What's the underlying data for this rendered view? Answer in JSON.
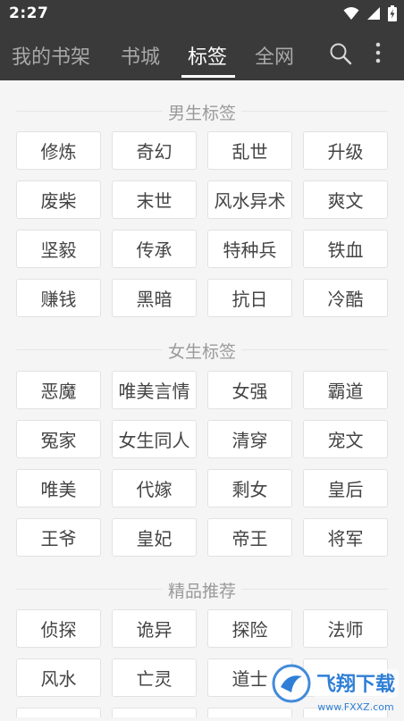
{
  "status_bar": {
    "time": "2:27",
    "icons": [
      "wifi-icon",
      "signal-icon",
      "battery-charging-icon"
    ]
  },
  "tabs": [
    {
      "label": "我的书架",
      "active": false
    },
    {
      "label": "书城",
      "active": false
    },
    {
      "label": "标签",
      "active": true
    },
    {
      "label": "全网",
      "active": false
    }
  ],
  "toolbar_icons": [
    "search-icon",
    "more-vert-icon"
  ],
  "sections": [
    {
      "title": "男生标签",
      "tags": [
        "修炼",
        "奇幻",
        "乱世",
        "升级",
        "废柴",
        "末世",
        "风水异术",
        "爽文",
        "坚毅",
        "传承",
        "特种兵",
        "铁血",
        "赚钱",
        "黑暗",
        "抗日",
        "冷酷"
      ]
    },
    {
      "title": "女生标签",
      "tags": [
        "恶魔",
        "唯美言情",
        "女强",
        "霸道",
        "冤家",
        "女生同人",
        "清穿",
        "宠文",
        "唯美",
        "代嫁",
        "剩女",
        "皇后",
        "王爷",
        "皇妃",
        "帝王",
        "将军"
      ]
    },
    {
      "title": "精品推荐",
      "tags": [
        "侦探",
        "诡异",
        "探险",
        "法师",
        "风水",
        "亡灵",
        "道士",
        "",
        "",
        "",
        "",
        ""
      ]
    }
  ],
  "watermark": {
    "text": "飞翔下载",
    "url_text": "www.FXXZ.com"
  },
  "colors": {
    "app_bar": "#3a3a3a",
    "tab_active": "#ffffff",
    "tab_inactive": "#a8a8a8",
    "background": "#f5f5f5",
    "tag_bg": "#ffffff",
    "tag_border": "#e2e2e2",
    "tag_text": "#444444",
    "section_title": "#9a9a9a",
    "watermark_blue": "#2f7fd6"
  }
}
